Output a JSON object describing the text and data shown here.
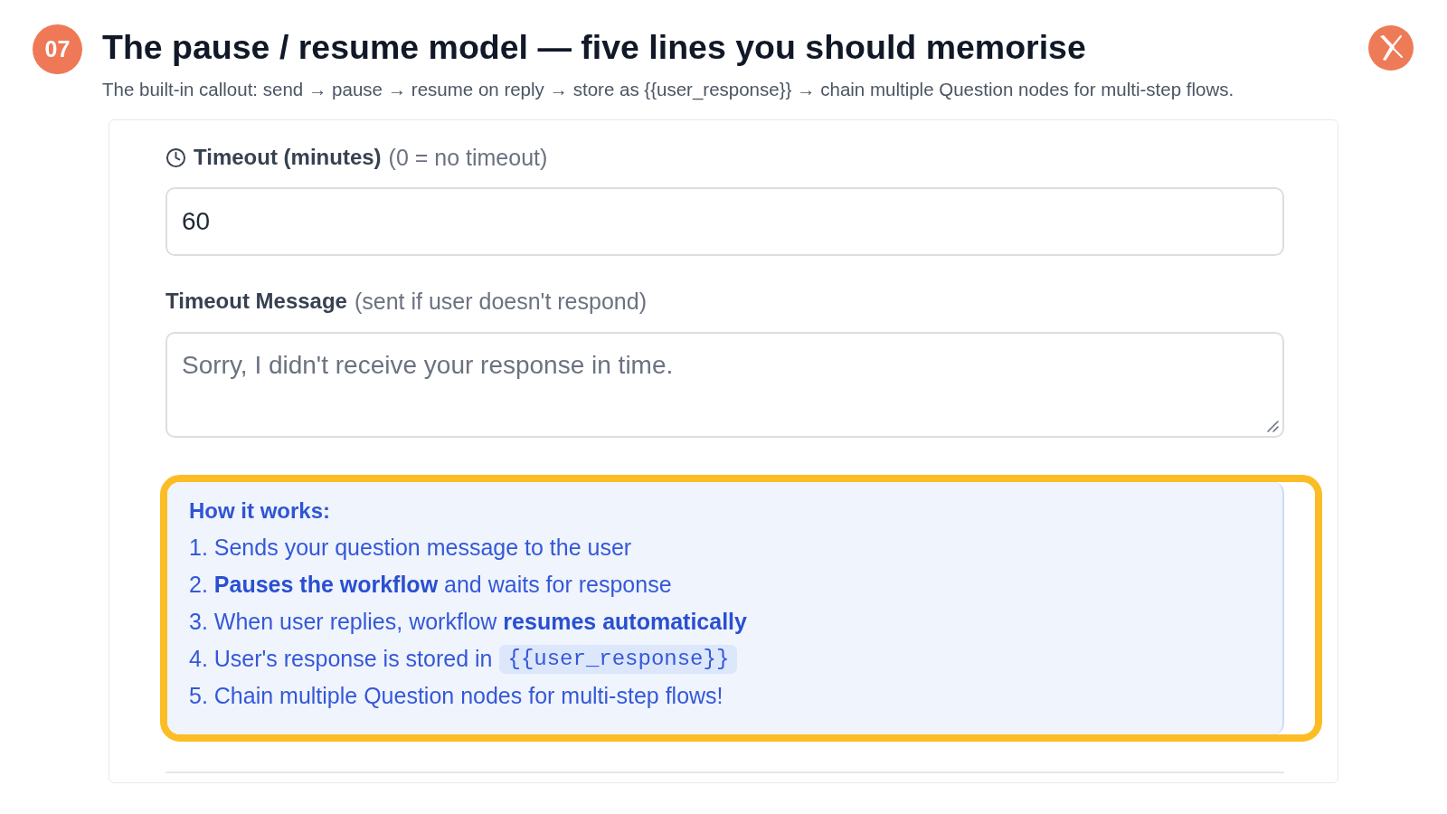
{
  "header": {
    "badge": "07",
    "title": "The pause / resume model — five lines you should memorise",
    "subtitle": "The built-in callout: send → pause → resume on reply → store as {{user_response}} → chain multiple Question nodes for multi-step flows."
  },
  "form": {
    "fields": [
      {
        "kind": "input",
        "show_icon": true,
        "label": "Timeout (minutes)",
        "hint": "(0 = no timeout)",
        "value": "60"
      },
      {
        "kind": "textarea",
        "show_icon": false,
        "label": "Timeout Message",
        "hint": "(sent if user doesn't respond)",
        "placeholder": "Sorry, I didn't receive your response in time."
      }
    ],
    "info_box": {
      "highlighted": true,
      "title": "How it works:",
      "steps": [
        {
          "text": "1. Sends your question message to the user"
        },
        {
          "text": "2. **Pauses the workflow** and waits for response"
        },
        {
          "text": "3. When user replies, workflow **resumes automatically**"
        },
        {
          "text": "4. User's response is stored in",
          "code": "{{user_response}}"
        },
        {
          "text": "5. Chain multiple Question nodes for multi-step flows!"
        }
      ]
    }
  }
}
